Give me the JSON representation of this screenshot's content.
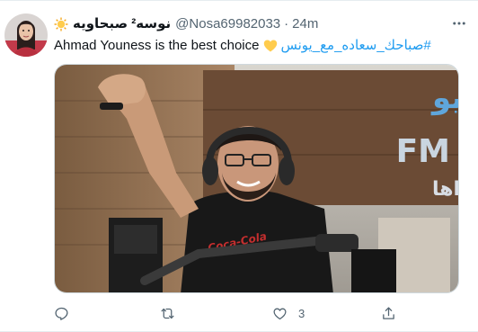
{
  "tweet": {
    "display_name": "نوسه² صبحاويه",
    "handle": "@Nosa69982033",
    "separator": "·",
    "time": "24m",
    "text_before": "Ahmad Youness is the best choice",
    "hashtag": "#صباحك_سعاده_مع_يونس",
    "icons": {
      "name_emoji": "sun-emoji-icon",
      "text_emoji": "yellow-heart-icon",
      "more": "more-icon",
      "reply": "reply-icon",
      "retweet": "retweet-icon",
      "like": "like-icon",
      "share": "share-icon"
    },
    "media": {
      "sign_line1": "الراديو",
      "sign_line2": "FM",
      "sign_line3": "هواها",
      "mug_text": "Coca-Cola"
    },
    "actions": {
      "reply_count": "",
      "retweet_count": "",
      "like_count": "3"
    },
    "colors": {
      "accent": "#1d9bf0",
      "secondary_text": "#536471",
      "heart": "#ffcc4d"
    }
  }
}
